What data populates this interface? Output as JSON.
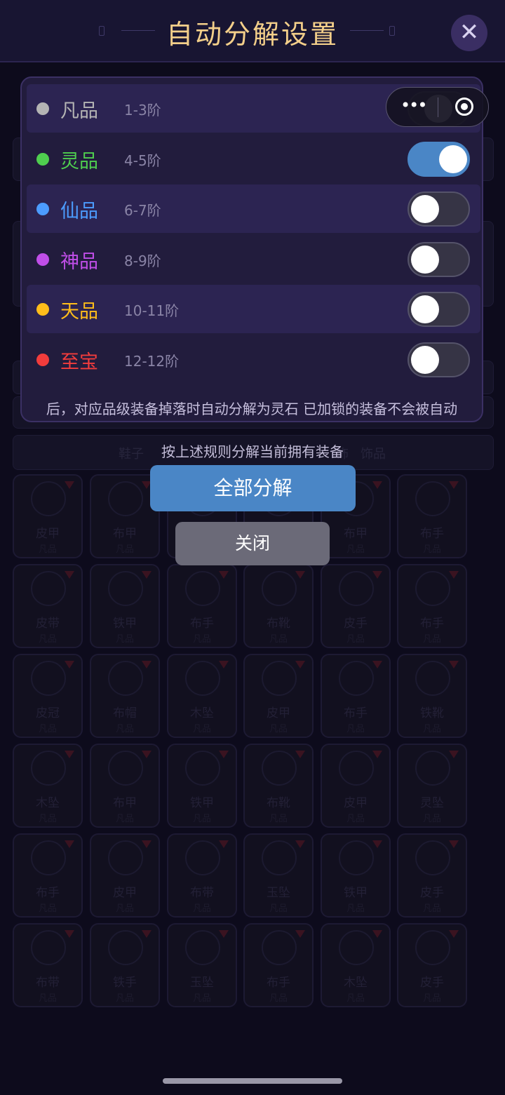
{
  "header": {
    "title": "自动分解设置",
    "close_icon": "close-x-icon"
  },
  "capsule": {
    "more_icon": "more-dots-icon",
    "exit_icon": "target-circle-icon"
  },
  "panel": {
    "rows": [
      {
        "name": "凡品",
        "range": "1-3阶",
        "color": "#b4b4b4",
        "enabled": false
      },
      {
        "name": "灵品",
        "range": "4-5阶",
        "color": "#4fce4f",
        "enabled": true
      },
      {
        "name": "仙品",
        "range": "6-7阶",
        "color": "#4c9cff",
        "enabled": false
      },
      {
        "name": "神品",
        "range": "8-9阶",
        "color": "#c04ee8",
        "enabled": false
      },
      {
        "name": "天品",
        "range": "10-11阶",
        "color": "#ffbd1a",
        "enabled": false
      },
      {
        "name": "至宝",
        "range": "12-12阶",
        "color": "#f23c3c",
        "enabled": false
      }
    ],
    "note": "后，对应品级装备掉落时自动分解为灵石 已加锁的装备不会被自动"
  },
  "actions": {
    "hint": "按上述规则分解当前拥有装备",
    "decompose_all": "全部分解",
    "close": "关闭"
  },
  "background": {
    "visible_labels": [
      "鞋子",
      "饰",
      "饰品"
    ],
    "items": [
      {
        "name": "皮甲",
        "grade": "凡品"
      },
      {
        "name": "布甲",
        "grade": "凡品"
      },
      {
        "name": "布甲",
        "grade": "凡品"
      },
      {
        "name": "布甲",
        "grade": "凡品"
      },
      {
        "name": "布甲",
        "grade": "凡品"
      },
      {
        "name": "布手",
        "grade": "凡品"
      },
      {
        "name": "皮带",
        "grade": "凡品"
      },
      {
        "name": "铁甲",
        "grade": "凡品"
      },
      {
        "name": "布手",
        "grade": "凡品"
      },
      {
        "name": "布靴",
        "grade": "凡品"
      },
      {
        "name": "皮手",
        "grade": "凡品"
      },
      {
        "name": "布手",
        "grade": "凡品"
      },
      {
        "name": "皮冠",
        "grade": "凡品"
      },
      {
        "name": "布帽",
        "grade": "凡品"
      },
      {
        "name": "木坠",
        "grade": "凡品"
      },
      {
        "name": "皮甲",
        "grade": "凡品"
      },
      {
        "name": "布手",
        "grade": "凡品"
      },
      {
        "name": "铁靴",
        "grade": "凡品"
      },
      {
        "name": "木坠",
        "grade": "凡品"
      },
      {
        "name": "布甲",
        "grade": "凡品"
      },
      {
        "name": "铁甲",
        "grade": "凡品"
      },
      {
        "name": "布靴",
        "grade": "凡品"
      },
      {
        "name": "皮甲",
        "grade": "凡品"
      },
      {
        "name": "灵坠",
        "grade": "凡品"
      },
      {
        "name": "布手",
        "grade": "凡品"
      },
      {
        "name": "皮甲",
        "grade": "凡品"
      },
      {
        "name": "布带",
        "grade": "凡品"
      },
      {
        "name": "玉坠",
        "grade": "凡品"
      },
      {
        "name": "铁甲",
        "grade": "凡品"
      },
      {
        "name": "皮手",
        "grade": "凡品"
      },
      {
        "name": "布带",
        "grade": "凡品"
      },
      {
        "name": "铁手",
        "grade": "凡品"
      },
      {
        "name": "玉坠",
        "grade": "凡品"
      },
      {
        "name": "布手",
        "grade": "凡品"
      },
      {
        "name": "木坠",
        "grade": "凡品"
      },
      {
        "name": "皮手",
        "grade": "凡品"
      }
    ]
  }
}
